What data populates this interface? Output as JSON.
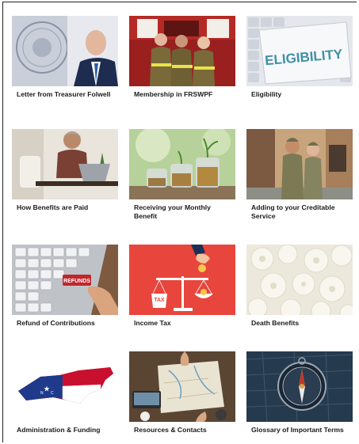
{
  "cards": [
    {
      "label": "Letter from Treasurer Folwell",
      "icon": "treasurer-photo"
    },
    {
      "label": "Membership in FRSWPF",
      "icon": "firefighters-photo"
    },
    {
      "label": "Eligibility",
      "icon": "eligibility-keyboard-photo",
      "image_text": "ELIGIBILITY"
    },
    {
      "label": "How Benefits are Paid",
      "icon": "man-at-laptop-photo"
    },
    {
      "label": "Receiving your Monthly Benefit",
      "icon": "coin-jars-photo"
    },
    {
      "label": "Adding to your Creditable Service",
      "icon": "soldiers-photo"
    },
    {
      "label": "Refund of Contributions",
      "icon": "refunds-keyboard-photo",
      "image_text": "REFUNDS"
    },
    {
      "label": "Income Tax",
      "icon": "tax-scale-illustration",
      "image_text": "TAX"
    },
    {
      "label": "Death Benefits",
      "icon": "white-flowers-photo"
    },
    {
      "label": "Administration & Funding",
      "icon": "nc-flag-map"
    },
    {
      "label": "Resources & Contacts",
      "icon": "map-desk-photo"
    },
    {
      "label": "Glossary of Important Terms",
      "icon": "compass-photo"
    }
  ]
}
